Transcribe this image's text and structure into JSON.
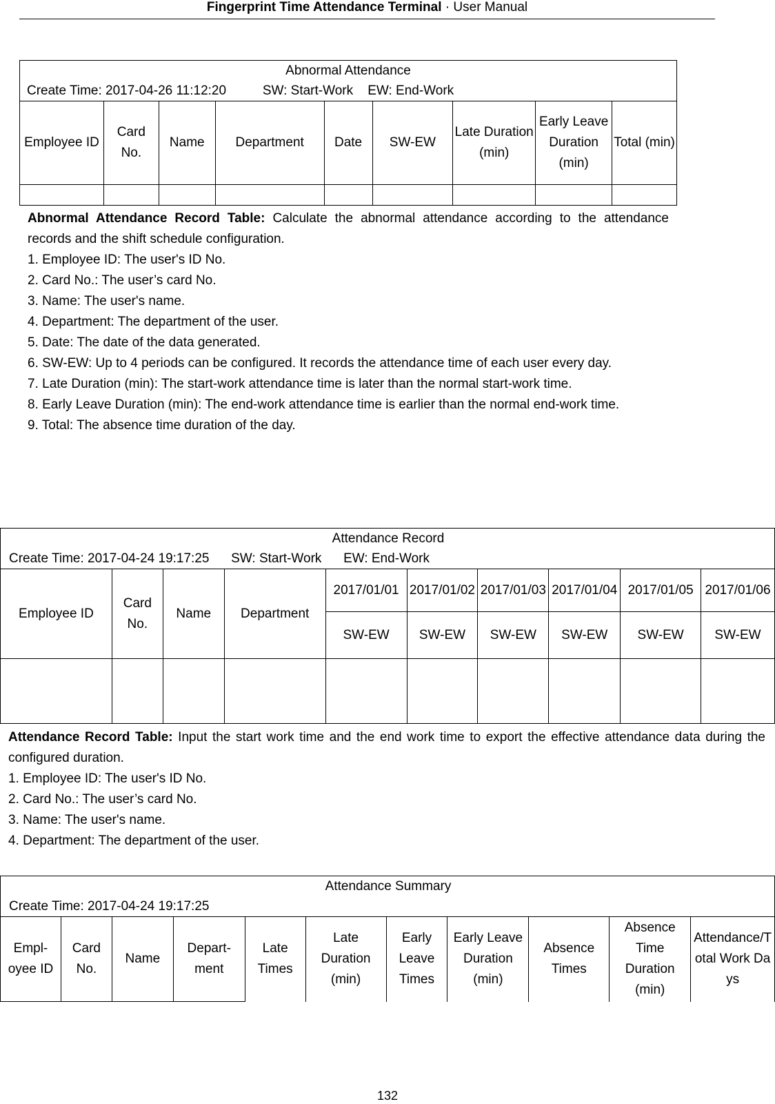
{
  "header": {
    "bold": "Fingerprint Time Attendance Terminal",
    "sep": " · ",
    "normal": "User Manual"
  },
  "abnormal": {
    "title": "Abnormal Attendance",
    "meta": "Create Time: 2017-04-26 11:12:20          SW: Start-Work    EW: End-Work",
    "columns": [
      "Employee ID",
      "Card No.",
      "Name",
      "Department",
      "Date",
      "SW-EW",
      "Late Duration (min)",
      "Early Leave Duration (min)",
      "Total (min)"
    ],
    "desc_title": "Abnormal Attendance Record Table:",
    "desc_intro": " Calculate the abnormal attendance according to the attendance records and the shift schedule configuration.",
    "items": [
      "1. Employee ID: The user's ID No.",
      "2. Card No.: The user’s card No.",
      "3. Name: The user's name.",
      "4. Department: The department of the user.",
      "5. Date: The date of the data generated.",
      "6. SW-EW: Up to 4 periods can be configured. It records the attendance time of each user every day.",
      "7. Late Duration (min): The start-work attendance time is later than the normal start-work time.",
      "8. Early Leave Duration (min): The end-work attendance time is earlier than the normal end-work time.",
      "9. Total: The absence time duration of the day."
    ]
  },
  "record": {
    "title": "Attendance Record",
    "meta": "Create Time: 2017-04-24 19:17:25      SW: Start-Work      EW: End-Work",
    "columns": [
      "Employee ID",
      "Card No.",
      "Name",
      "Department"
    ],
    "dates": [
      "2017/01/01",
      "2017/01/02",
      "2017/01/03",
      "2017/01/04",
      "2017/01/05",
      "2017/01/06"
    ],
    "sub": "SW-EW",
    "desc_title": "Attendance Record Table:",
    "desc_intro": " Input the start work time and the end work time to export the effective attendance data during the configured duration.",
    "items": [
      "1. Employee ID: The user's ID No.",
      "2. Card No.: The user’s card No.",
      "3. Name: The user's name.",
      "4. Department: The department of the user."
    ]
  },
  "summary": {
    "title": "Attendance Summary",
    "meta": "Create Time: 2017-04-24 19:17:25",
    "columns": [
      "Empl-oyee ID",
      "Card No.",
      "Name",
      "Depart-ment",
      "Late Times",
      "Late Duration (min)",
      "Early Leave Times",
      "Early Leave Duration (min)",
      "Absence Times",
      "Absence Time Duration (min)",
      "Attendance/Total Work Days"
    ]
  },
  "page_number": "132"
}
